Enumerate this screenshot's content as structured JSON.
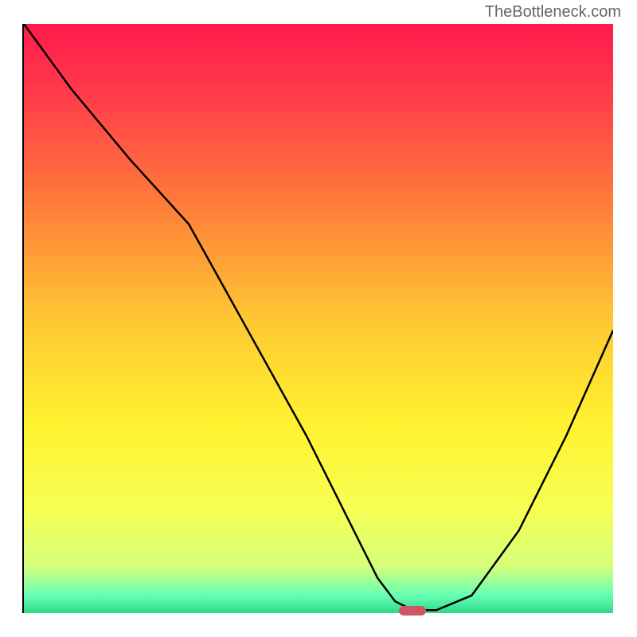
{
  "watermark": "TheBottleneck.com",
  "chart_data": {
    "type": "line",
    "title": "",
    "xlabel": "",
    "ylabel": "",
    "xlim": [
      0,
      100
    ],
    "ylim": [
      0,
      100
    ],
    "gradient_stops": [
      {
        "pos": 0.0,
        "color": "#ff1a4d"
      },
      {
        "pos": 0.12,
        "color": "#ff3c4a"
      },
      {
        "pos": 0.3,
        "color": "#ff7a3a"
      },
      {
        "pos": 0.5,
        "color": "#ffc733"
      },
      {
        "pos": 0.68,
        "color": "#fff230"
      },
      {
        "pos": 0.82,
        "color": "#f7ff52"
      },
      {
        "pos": 0.92,
        "color": "#d6ff7a"
      },
      {
        "pos": 0.97,
        "color": "#66ffb3"
      },
      {
        "pos": 1.0,
        "color": "#2cd98a"
      }
    ],
    "series": [
      {
        "name": "bottleneck-curve",
        "x": [
          0,
          8,
          18,
          28,
          38,
          48,
          56,
          60,
          63,
          66,
          70,
          76,
          84,
          92,
          100
        ],
        "y": [
          100,
          89,
          77,
          66,
          48,
          30,
          14,
          6,
          2,
          0.5,
          0.5,
          3,
          14,
          30,
          48
        ]
      }
    ],
    "optimal_marker": {
      "x": 66,
      "y": 0,
      "color": "#d05565"
    }
  }
}
